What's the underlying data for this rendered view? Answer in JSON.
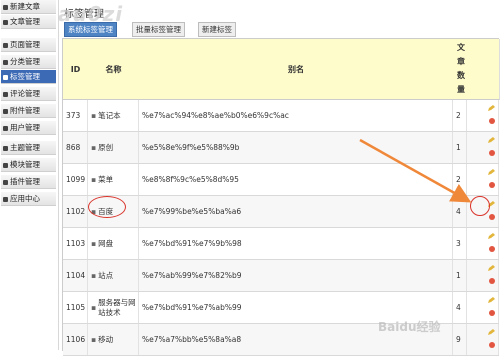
{
  "watermark_text": "au0zi",
  "sidebar": {
    "items": [
      {
        "label": "新建文章",
        "icon": "new-article-icon"
      },
      {
        "label": "文章管理",
        "icon": "articles-icon"
      },
      {
        "label": "页面管理",
        "icon": "pages-icon"
      },
      {
        "label": "分类管理",
        "icon": "folder-icon"
      },
      {
        "label": "标签管理",
        "icon": "tag-icon",
        "active": true
      },
      {
        "label": "评论管理",
        "icon": "comment-icon"
      },
      {
        "label": "附件管理",
        "icon": "attachment-icon"
      },
      {
        "label": "用户管理",
        "icon": "user-icon"
      },
      {
        "label": "主题管理",
        "icon": "theme-icon"
      },
      {
        "label": "模块管理",
        "icon": "module-icon"
      },
      {
        "label": "插件管理",
        "icon": "plugin-icon"
      },
      {
        "label": "应用中心",
        "icon": "app-center-icon"
      }
    ]
  },
  "header": {
    "title": "标签管理",
    "tabs": [
      {
        "label": "系统标签管理",
        "active": true
      },
      {
        "label": "批量标签管理"
      },
      {
        "label": "新建标签"
      }
    ]
  },
  "table": {
    "columns": {
      "id": "ID",
      "name": "名称",
      "alias": "别名",
      "count": "文章数量"
    },
    "rows": [
      {
        "id": "373",
        "name": "笔记本",
        "alias": "%e7%ac%94%e8%ae%b0%e6%9c%ac",
        "count": "2"
      },
      {
        "id": "868",
        "name": "原创",
        "alias": "%e5%8e%9f%e5%88%9b",
        "count": "1"
      },
      {
        "id": "1099",
        "name": "菜单",
        "alias": "%e8%8f%9c%e5%8d%95",
        "count": "2"
      },
      {
        "id": "1102",
        "name": "百度",
        "alias": "%e7%99%be%e5%ba%a6",
        "count": "4"
      },
      {
        "id": "1103",
        "name": "网盘",
        "alias": "%e7%bd%91%e7%9b%98",
        "count": "3"
      },
      {
        "id": "1104",
        "name": "站点",
        "alias": "%e7%ab%99%e7%82%b9",
        "count": "1"
      },
      {
        "id": "1105",
        "name": "服务器与网站技术",
        "alias": "%e7%bd%91%e7%ab%99",
        "count": "4"
      },
      {
        "id": "1106",
        "name": "移动",
        "alias": "%e7%a7%bb%e5%8a%a8",
        "count": "9"
      }
    ]
  },
  "colors": {
    "accent": "#3d6ab4",
    "header_bg": "#fffccc",
    "annotation": "#d9342b",
    "arrow": "#f0883a"
  },
  "footer_watermark": "Baidu经验"
}
